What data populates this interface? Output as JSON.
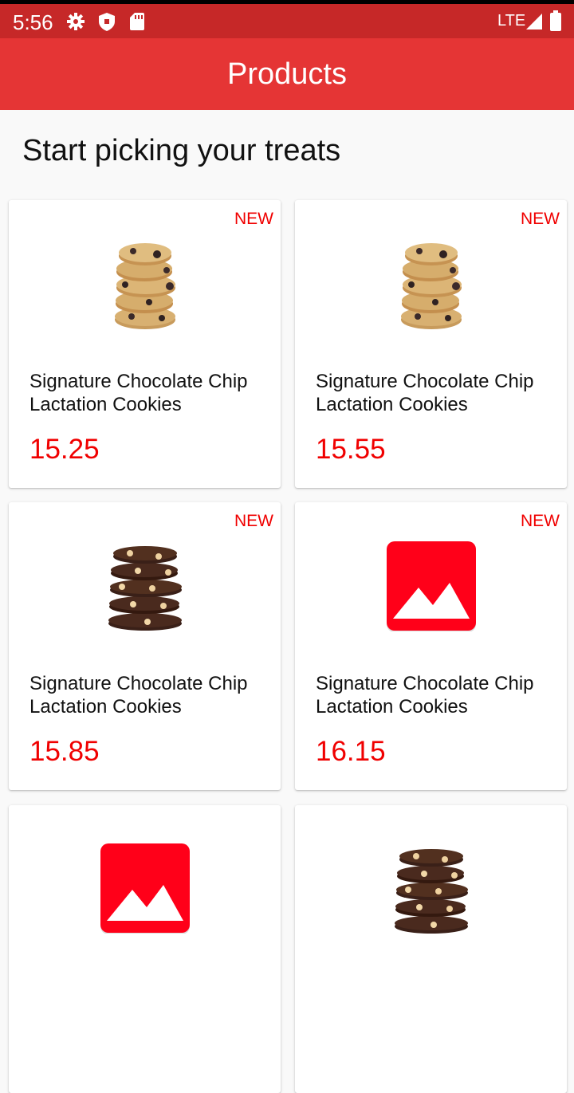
{
  "status_bar": {
    "time": "5:56",
    "network": "LTE"
  },
  "app_bar": {
    "title": "Products"
  },
  "headline": "Start picking your treats",
  "products": [
    {
      "name": "Signature Chocolate Chip Lactation Cookies",
      "price": "15.25",
      "badge": "NEW",
      "image": "oatmeal-raisin-cookie-stack"
    },
    {
      "name": "Signature Chocolate Chip Lactation Cookies",
      "price": "15.55",
      "badge": "NEW",
      "image": "oatmeal-raisin-cookie-stack"
    },
    {
      "name": "Signature Chocolate Chip Lactation Cookies",
      "price": "15.85",
      "badge": "NEW",
      "image": "double-chocolate-cookie-stack"
    },
    {
      "name": "Signature Chocolate Chip Lactation Cookies",
      "price": "16.15",
      "badge": "NEW",
      "image": "image-placeholder-icon"
    },
    {
      "image": "image-placeholder-icon"
    },
    {
      "image": "double-chocolate-cookie-stack"
    }
  ],
  "colors": {
    "status_bar": "#c62828",
    "app_bar": "#e53535",
    "accent": "#f00000",
    "placeholder": "#ff0019"
  }
}
